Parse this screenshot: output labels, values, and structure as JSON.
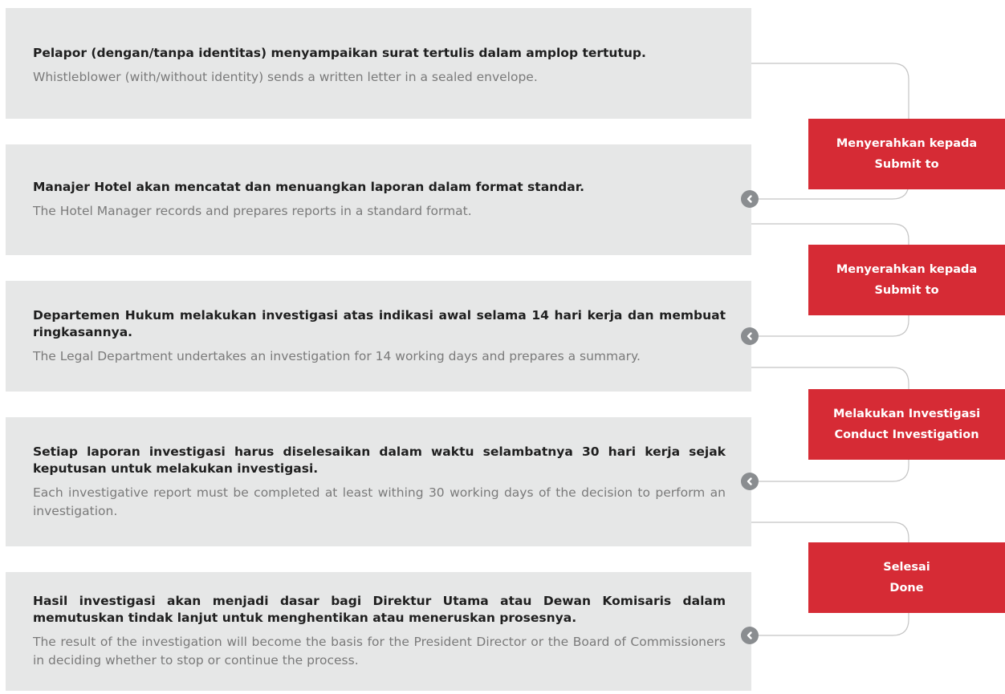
{
  "steps": [
    {
      "id": "Pelapor (dengan/tanpa identitas) menyampaikan surat tertulis dalam amplop tertutup.",
      "en": "Whistleblower (with/without identity) sends a written letter in a sealed envelope."
    },
    {
      "id": "Manajer Hotel akan mencatat dan menuangkan laporan dalam format standar.",
      "en": "The Hotel Manager records and prepares reports in a standard format."
    },
    {
      "id": "Departemen Hukum melakukan investigasi atas indikasi awal selama 14 hari kerja dan membuat ringkasannya.",
      "en": "The Legal Department undertakes an investigation for 14 working days and prepares a summary."
    },
    {
      "id": "Setiap laporan investigasi harus diselesaikan dalam waktu selambatnya 30 hari kerja sejak keputusan untuk melakukan investigasi.",
      "en": "Each investigative report must be completed at least withing 30 working days of the decision to perform an investigation."
    },
    {
      "id": "Hasil investigasi akan menjadi dasar bagi Direktur Utama atau Dewan Komisaris dalam memutuskan tindak lanjut untuk menghentikan atau meneruskan prosesnya.",
      "en": "The result of the investigation will become the basis for the President Director or the Board of Commissioners in deciding whether to stop or continue the process."
    }
  ],
  "actions": [
    {
      "id": "Menyerahkan kepada",
      "en": "Submit to"
    },
    {
      "id": "Menyerahkan kepada",
      "en": "Submit to"
    },
    {
      "id": "Melakukan Investigasi",
      "en": "Conduct Investigation"
    },
    {
      "id": "Selesai",
      "en": "Done"
    }
  ],
  "colors": {
    "accent": "#d62b35",
    "step_bg": "#e6e7e7",
    "connector": "#c4c4c4",
    "bullet": "#8a8d90"
  },
  "icons": {
    "bullet": "chevron-left-circle-icon"
  }
}
